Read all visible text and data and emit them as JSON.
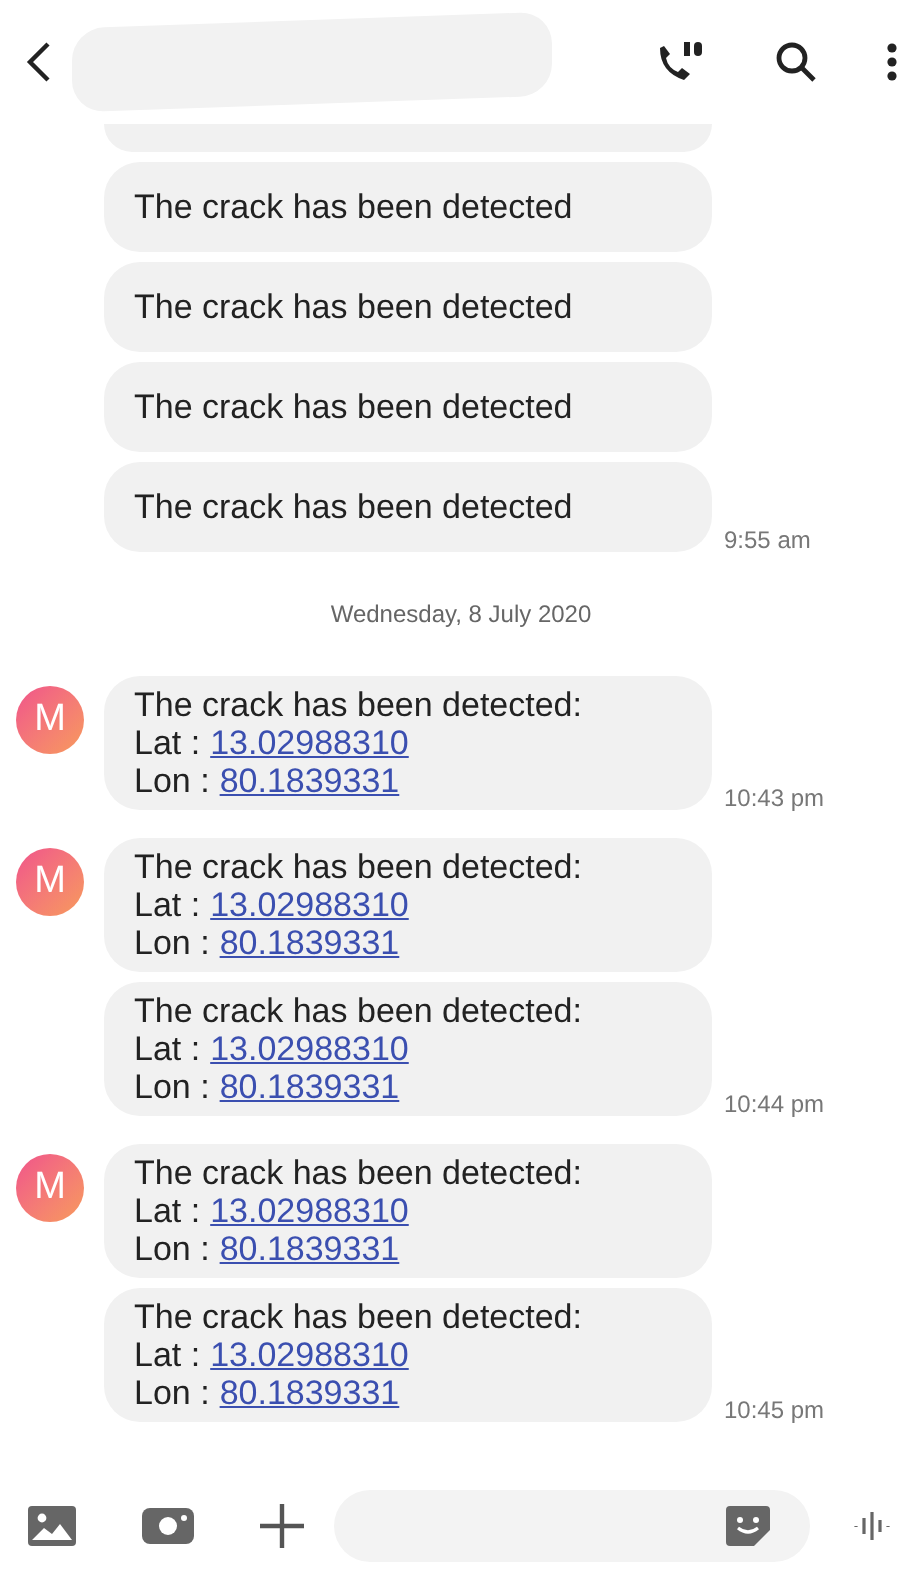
{
  "thread": [
    {
      "kind": "group",
      "bubbles": [
        {
          "kind": "cut"
        },
        {
          "kind": "plain",
          "text": "The crack has been detected"
        },
        {
          "kind": "plain",
          "text": "The crack has been detected"
        },
        {
          "kind": "plain",
          "text": "The crack has been detected"
        },
        {
          "kind": "plain",
          "text": "The crack has been detected"
        }
      ],
      "time": "9:55 am"
    },
    {
      "kind": "date",
      "text": "Wednesday, 8 July 2020"
    },
    {
      "kind": "group",
      "avatar": "M",
      "bubbles": [
        {
          "kind": "location",
          "text": "The crack has been detected:",
          "lat_label": "Lat :",
          "lat": "13.02988310",
          "lon_label": "Lon :",
          "lon": "80.1839331"
        }
      ],
      "time": "10:43 pm"
    },
    {
      "kind": "group",
      "avatar": "M",
      "bubbles": [
        {
          "kind": "location",
          "text": "The crack has been detected:",
          "lat_label": "Lat :",
          "lat": "13.02988310",
          "lon_label": "Lon :",
          "lon": "80.1839331"
        },
        {
          "kind": "location",
          "text": "The crack has been detected:",
          "lat_label": "Lat :",
          "lat": "13.02988310",
          "lon_label": "Lon :",
          "lon": "80.1839331"
        }
      ],
      "time": "10:44 pm"
    },
    {
      "kind": "group",
      "avatar": "M",
      "bubbles": [
        {
          "kind": "location",
          "text": "The crack has been detected:",
          "lat_label": "Lat :",
          "lat": "13.02988310",
          "lon_label": "Lon :",
          "lon": "80.1839331"
        },
        {
          "kind": "location",
          "text": "The crack has been detected:",
          "lat_label": "Lat :",
          "lat": "13.02988310",
          "lon_label": "Lon :",
          "lon": "80.1839331"
        }
      ],
      "time": "10:45 pm"
    }
  ]
}
